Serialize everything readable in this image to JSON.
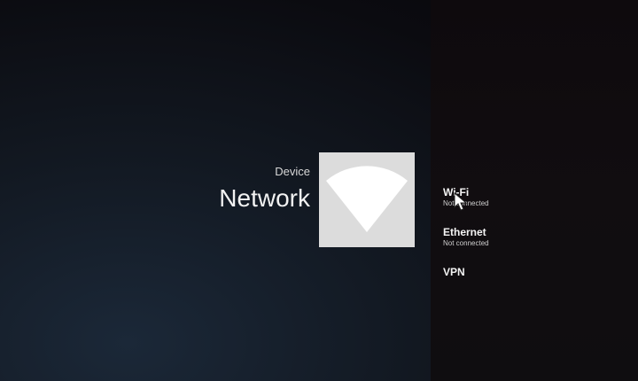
{
  "header": {
    "category": "Device",
    "title": "Network"
  },
  "hero": {
    "icon": "wifi-icon",
    "tile_color": "#dcdcdc",
    "icon_color": "#ffffff"
  },
  "menu": {
    "items": [
      {
        "label": "Wi-Fi",
        "status": "Not connected"
      },
      {
        "label": "Ethernet",
        "status": "Not connected"
      },
      {
        "label": "VPN",
        "status": ""
      }
    ]
  }
}
